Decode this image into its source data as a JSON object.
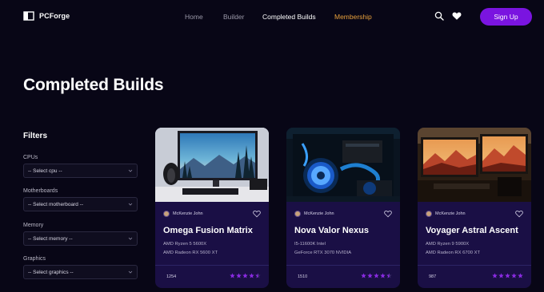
{
  "brand": {
    "name": "PCForge"
  },
  "nav": {
    "links": [
      "Home",
      "Builder",
      "Completed Builds",
      "Membership"
    ],
    "signup_label": "Sign Up"
  },
  "page": {
    "title": "Completed Builds"
  },
  "filters": {
    "title": "Filters",
    "groups": [
      {
        "label": "CPUs",
        "value": "-- Select cpu --"
      },
      {
        "label": "Motherboards",
        "value": "-- Select motherboard --"
      },
      {
        "label": "Memory",
        "value": "-- Select memory --"
      },
      {
        "label": "Graphics",
        "value": "-- Select graphics --"
      }
    ]
  },
  "cards": [
    {
      "author": "McKenzie John",
      "name": "Omega Fusion Matrix",
      "specs": [
        "AMD Ryzen 5 5600X",
        "AMD Radeon RX 5600 XT"
      ],
      "count": "1254",
      "rating": 4.5
    },
    {
      "author": "McKenzie John",
      "name": "Nova Valor Nexus",
      "specs": [
        "I5-11600K Intel",
        "GeForce RTX 3070 NVIDIA"
      ],
      "count": "1510",
      "rating": 4.5
    },
    {
      "author": "McKenzie John",
      "name": "Voyager Astral Ascent",
      "specs": [
        "AMD Ryzen 9 5900X",
        "AMD Radeon RX 6700 XT"
      ],
      "count": "987",
      "rating": 5
    }
  ],
  "colors": {
    "background": "#080616",
    "accent": "#7a14e0",
    "card": "#1a0f45",
    "membership": "#e8a03c",
    "star": "#8a2be2"
  },
  "icons": {
    "search": "search-icon",
    "wishlist": "heart-icon",
    "logo": "logo-icon"
  }
}
